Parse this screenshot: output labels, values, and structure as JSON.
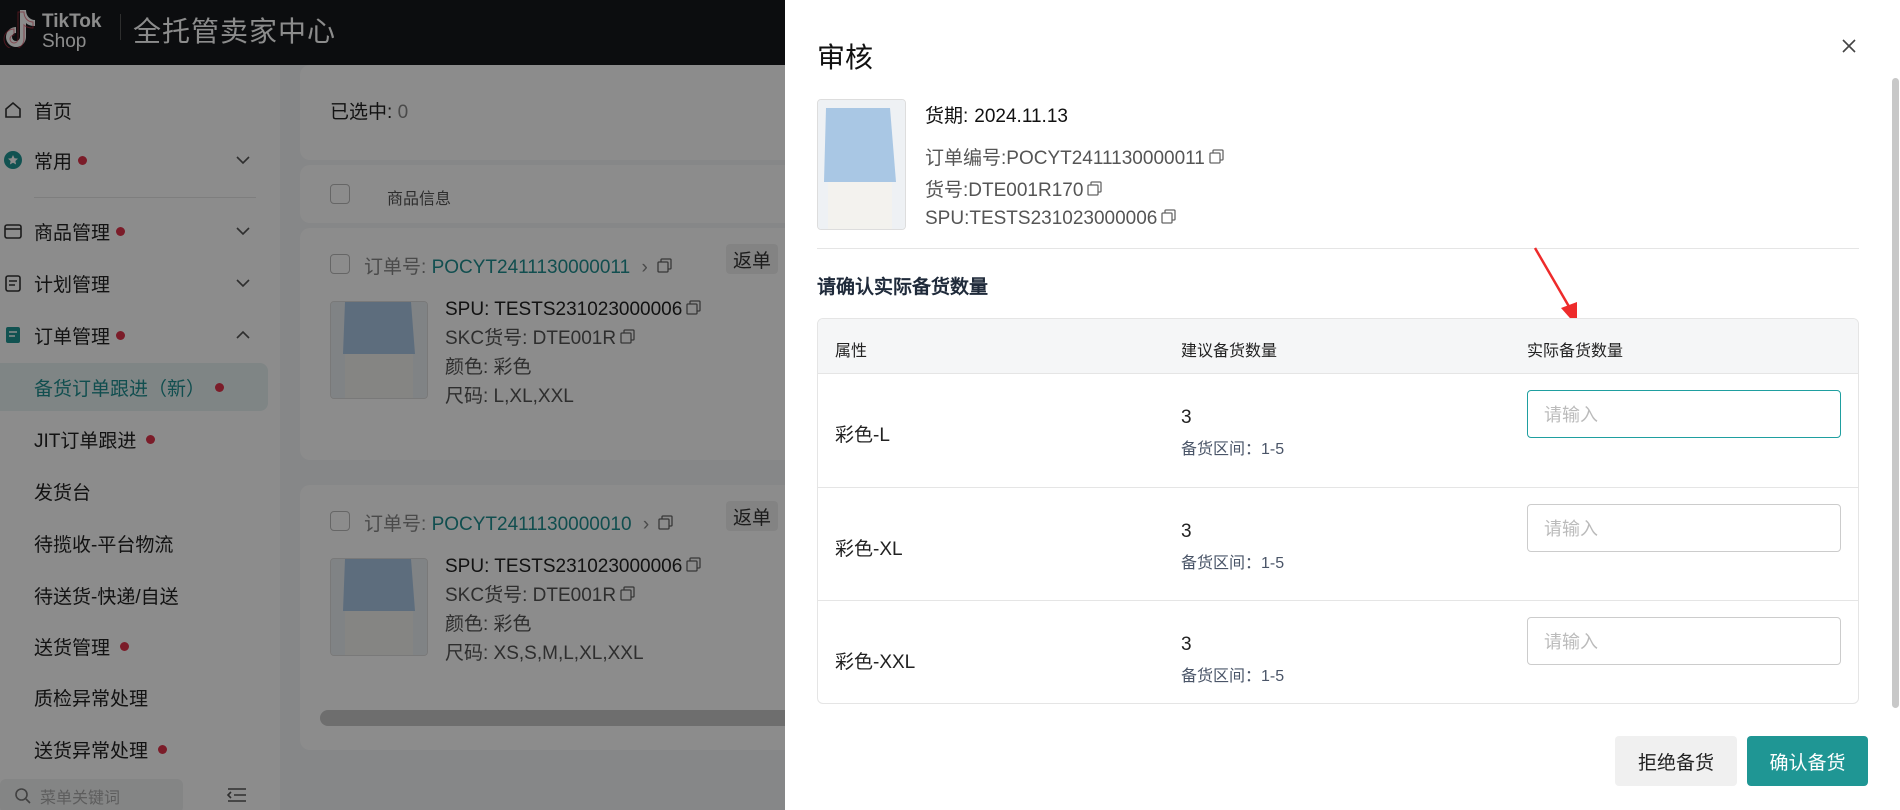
{
  "header": {
    "logo_line1": "TikTok",
    "logo_line2": "Shop",
    "title": "全托管卖家中心"
  },
  "sidebar": {
    "items": [
      {
        "label": "首页",
        "icon": "home-icon"
      },
      {
        "label": "常用",
        "icon": "star-icon",
        "dot": true
      },
      {
        "label": "商品管理",
        "icon": "product-icon",
        "dot": true
      },
      {
        "label": "计划管理",
        "icon": "plan-icon"
      },
      {
        "label": "订单管理",
        "icon": "order-icon",
        "dot": true
      }
    ],
    "sub_items": [
      {
        "label": "备货订单跟进（新）",
        "dot": true,
        "active": true
      },
      {
        "label": "JIT订单跟进",
        "dot": true
      },
      {
        "label": "发货台"
      },
      {
        "label": "待揽收-平台物流"
      },
      {
        "label": "待送货-快递/自送"
      },
      {
        "label": "送货管理",
        "dot": true
      },
      {
        "label": "质检异常处理"
      },
      {
        "label": "送货异常处理",
        "dot": true
      }
    ],
    "search_placeholder": "菜单关键词"
  },
  "main": {
    "selected_label": "已选中: ",
    "selected_count": "0",
    "column_product": "商品信息",
    "orders": [
      {
        "order_label": "订单号:",
        "order_no": "POCYT2411130000011",
        "chip": "返单",
        "spu": "SPU: TESTS231023000006",
        "skc": "SKC货号: DTE001R",
        "color": "颜色: 彩色",
        "size": "尺码: L,XL,XXL"
      },
      {
        "order_label": "订单号:",
        "order_no": "POCYT2411130000010",
        "chip": "返单",
        "spu": "SPU: TESTS231023000006",
        "skc": "SKC货号: DTE001R",
        "color": "颜色: 彩色",
        "size": "尺码: XS,S,M,L,XL,XXL"
      }
    ]
  },
  "drawer": {
    "title": "审核",
    "delivery_label": "货期:",
    "delivery_date": "2024.11.13",
    "order_no": "订单编号:POCYT2411130000011",
    "sku_no": "货号:DTE001R170",
    "spu": "SPU:TESTS231023000006",
    "section_title": "请确认实际备货数量",
    "columns": [
      "属性",
      "建议备货数量",
      "实际备货数量"
    ],
    "rows": [
      {
        "attr": "彩色-L",
        "suggested": "3",
        "range": "备货区间：1-5",
        "placeholder": "请输入"
      },
      {
        "attr": "彩色-XL",
        "suggested": "3",
        "range": "备货区间：1-5",
        "placeholder": "请输入"
      },
      {
        "attr": "彩色-XXL",
        "suggested": "3",
        "range": "备货区间：1-5",
        "placeholder": "请输入"
      }
    ],
    "reject_label": "拒绝备货",
    "confirm_label": "确认备货"
  },
  "colors": {
    "accent": "#1f9694",
    "dot": "#e0344b",
    "topbar": "#17191c"
  }
}
